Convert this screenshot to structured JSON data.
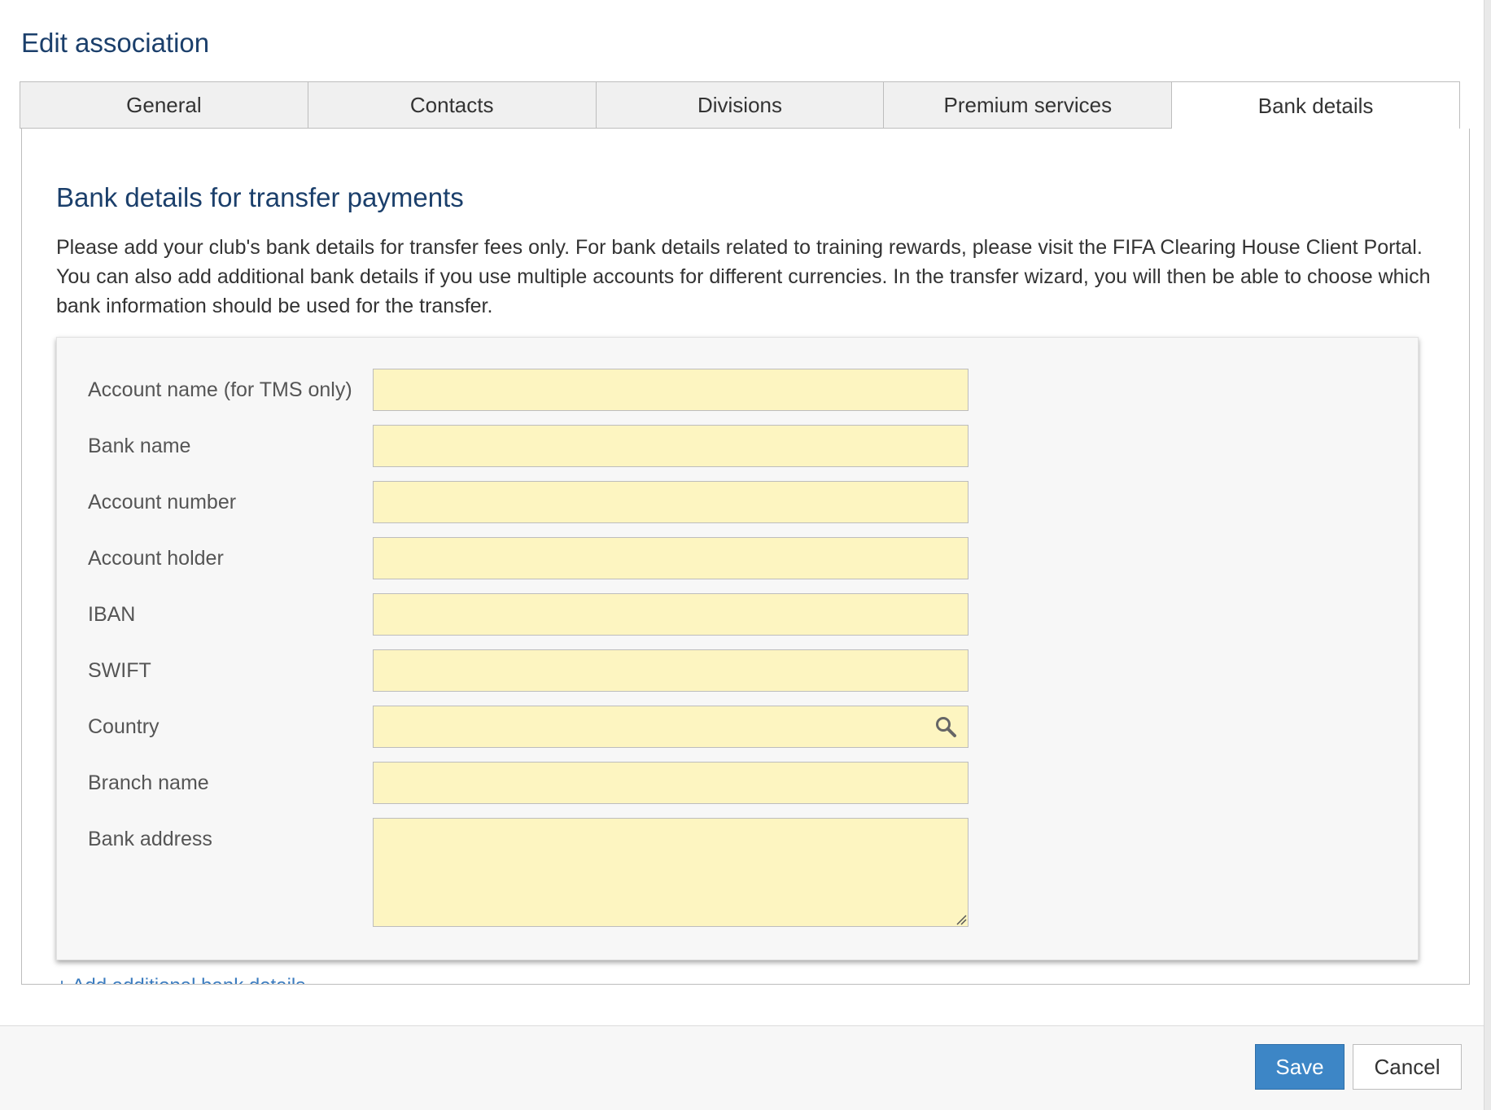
{
  "dialog": {
    "title": "Edit association"
  },
  "tabs": [
    {
      "label": "General",
      "active": false
    },
    {
      "label": "Contacts",
      "active": false
    },
    {
      "label": "Divisions",
      "active": false
    },
    {
      "label": "Premium services",
      "active": false
    },
    {
      "label": "Bank details",
      "active": true
    }
  ],
  "bank_details": {
    "section_title": "Bank details for transfer payments",
    "description": "Please add your club's bank details for transfer fees only. For bank details related to training rewards, please visit the FIFA Clearing House Client Portal. You can also add additional bank details if you use multiple accounts for different currencies. In the transfer wizard, you will then be able to choose which bank information should be used for the transfer.",
    "fields": {
      "account_name": {
        "label": "Account name (for TMS only)",
        "value": ""
      },
      "bank_name": {
        "label": "Bank name",
        "value": ""
      },
      "account_number": {
        "label": "Account number",
        "value": ""
      },
      "account_holder": {
        "label": "Account holder",
        "value": ""
      },
      "iban": {
        "label": "IBAN",
        "value": ""
      },
      "swift": {
        "label": "SWIFT",
        "value": ""
      },
      "country": {
        "label": "Country",
        "value": ""
      },
      "branch_name": {
        "label": "Branch name",
        "value": ""
      },
      "bank_address": {
        "label": "Bank address",
        "value": ""
      }
    },
    "add_link": "+ Add additional bank details"
  },
  "footer": {
    "save_label": "Save",
    "cancel_label": "Cancel"
  },
  "colors": {
    "title": "#1b3f6b",
    "input_background": "#fdf5c1",
    "primary_button": "#3d86c6",
    "link": "#3a7bbf"
  },
  "icons": {
    "country_lookup": "search-icon",
    "textarea_resize": "resize-handle-icon"
  }
}
